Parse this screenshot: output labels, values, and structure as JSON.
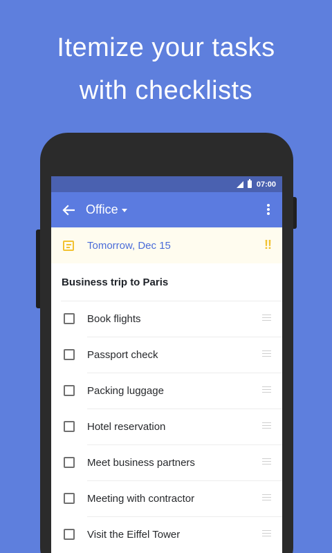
{
  "headline": {
    "line1": "Itemize your tasks",
    "line2": "with checklists"
  },
  "status_bar": {
    "time": "07:00",
    "icons": [
      "signal-icon",
      "battery-icon"
    ]
  },
  "app_bar": {
    "title": "Office",
    "icons": [
      "back-arrow-icon",
      "dropdown-caret-icon",
      "more-vert-icon"
    ]
  },
  "due": {
    "text": "Tomorrow, Dec 15",
    "priority": "!!",
    "icon": "note-icon"
  },
  "task": {
    "title": "Business trip to Paris"
  },
  "checklist": [
    {
      "label": "Book flights",
      "checked": false
    },
    {
      "label": "Passport check",
      "checked": false
    },
    {
      "label": "Packing luggage",
      "checked": false
    },
    {
      "label": "Hotel reservation",
      "checked": false
    },
    {
      "label": "Meet business partners",
      "checked": false
    },
    {
      "label": "Meeting with contractor",
      "checked": false
    },
    {
      "label": "Visit the Eiffel Tower",
      "checked": false
    }
  ],
  "colors": {
    "background": "#5e7fdd",
    "app_bar": "#5b7be0",
    "status_bar": "#4a61b0",
    "accent_yellow": "#f2c230",
    "due_text": "#4a6cd9"
  }
}
